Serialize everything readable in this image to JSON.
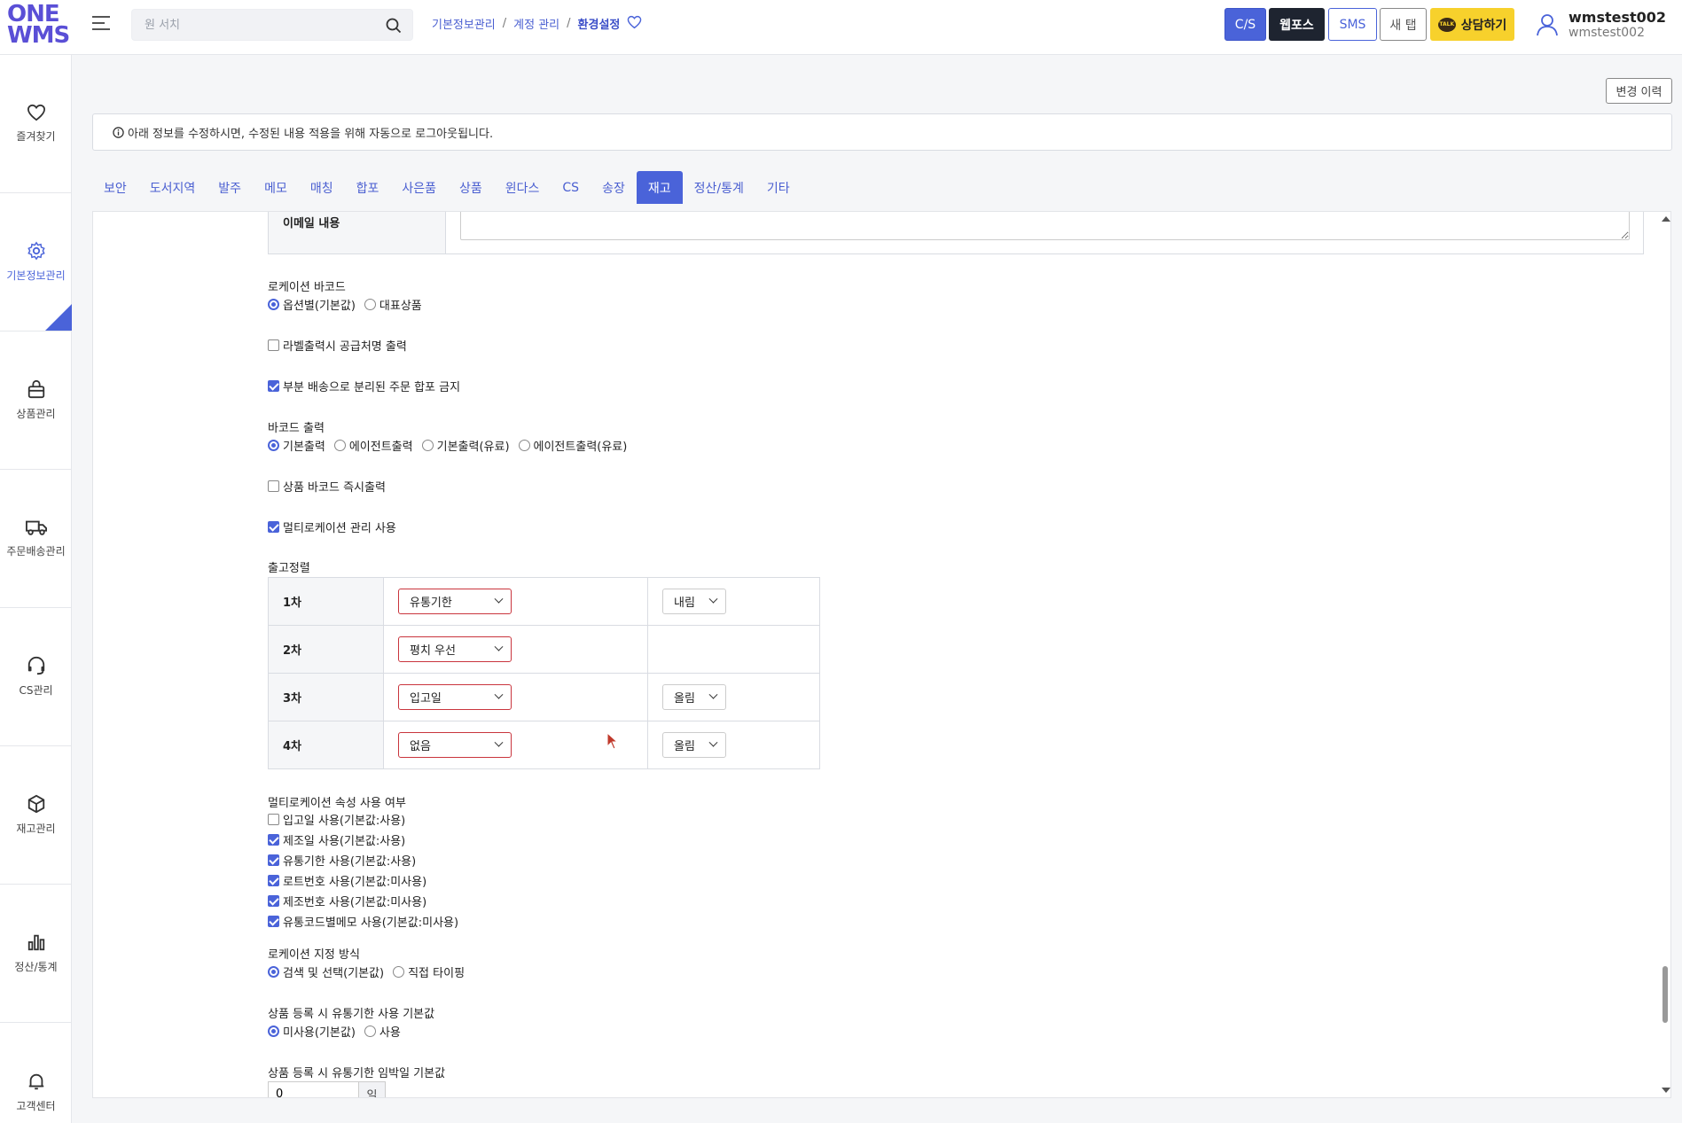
{
  "header": {
    "logo_line1": "ONE",
    "logo_line2": "WMS",
    "search_placeholder": "원 서치",
    "breadcrumb": [
      "기본정보관리",
      "계정 관리",
      "환경설정"
    ],
    "buttons": {
      "cs": "C/S",
      "web": "웹포스",
      "sms": "SMS",
      "newtab": "새 탭",
      "talk": "상담하기",
      "talk_badge": "TALK"
    },
    "user": {
      "name": "wmstest002",
      "id": "wmstest002"
    }
  },
  "sidebar": [
    {
      "label": "즐겨찾기",
      "icon": "heart-icon"
    },
    {
      "label": "기본정보관리",
      "icon": "gear-icon",
      "active": true
    },
    {
      "label": "상품관리",
      "icon": "bag-icon"
    },
    {
      "label": "주문배송관리",
      "icon": "truck-icon"
    },
    {
      "label": "CS관리",
      "icon": "headset-icon"
    },
    {
      "label": "재고관리",
      "icon": "box-icon"
    },
    {
      "label": "정산/통계",
      "icon": "bar-chart-icon"
    },
    {
      "label": "고객센터",
      "icon": "bell-icon"
    }
  ],
  "main": {
    "history_button": "변경 이력",
    "notice": "아래 정보를 수정하시면, 수정된 내용 적용을 위해 자동으로 로그아웃됩니다.",
    "tabs": [
      "보안",
      "도서지역",
      "발주",
      "메모",
      "매칭",
      "합포",
      "사은품",
      "상품",
      "윈다스",
      "CS",
      "송장",
      "재고",
      "정산/통계",
      "기타"
    ],
    "active_tab": "재고",
    "email_label": "이메일 내용",
    "location_barcode": {
      "label": "로케이션 바코드",
      "options": [
        "옵션별(기본값)",
        "대표상품"
      ],
      "selected": "옵션별(기본값)"
    },
    "label_print_supplier": {
      "label": "라벨출력시 공급처명 출력",
      "checked": false
    },
    "partial_ship_block": {
      "label": "부분 배송으로 분리된 주문 합포 금지",
      "checked": true
    },
    "barcode_output": {
      "label": "바코드 출력",
      "options": [
        "기본출력",
        "에이전트출력",
        "기본출력(유료)",
        "에이전트출력(유료)"
      ],
      "selected": "기본출력"
    },
    "instant_barcode": {
      "label": "상품 바코드 즉시출력",
      "checked": false
    },
    "multi_location": {
      "label": "멀티로케이션 관리 사용",
      "checked": true
    },
    "outbound_sort": {
      "label": "출고정렬",
      "rows": [
        {
          "rank": "1차",
          "field": "유통기한",
          "order": "내림"
        },
        {
          "rank": "2차",
          "field": "평치 우선",
          "order": ""
        },
        {
          "rank": "3차",
          "field": "입고일",
          "order": "올림"
        },
        {
          "rank": "4차",
          "field": "없음",
          "order": "올림"
        }
      ]
    },
    "multi_location_attrs": {
      "label": "멀티로케이션 속성 사용 여부",
      "items": [
        {
          "label": "입고일 사용(기본값:사용)",
          "checked": false
        },
        {
          "label": "제조일 사용(기본값:사용)",
          "checked": true
        },
        {
          "label": "유통기한 사용(기본값:사용)",
          "checked": true
        },
        {
          "label": "로트번호 사용(기본값:미사용)",
          "checked": true
        },
        {
          "label": "제조번호 사용(기본값:미사용)",
          "checked": true
        },
        {
          "label": "유통코드별메모 사용(기본값:미사용)",
          "checked": true
        }
      ]
    },
    "location_assign": {
      "label": "로케이션 지정 방식",
      "options": [
        "검색 및 선택(기본값)",
        "직접 타이핑"
      ],
      "selected": "검색 및 선택(기본값)"
    },
    "expiry_default": {
      "label": "상품 등록 시 유통기한 사용 기본값",
      "options": [
        "미사용(기본값)",
        "사용"
      ],
      "selected": "미사용(기본값)"
    },
    "expiry_imminent": {
      "label": "상품 등록 시 유통기한 임박일 기본값",
      "value": "0",
      "unit": "일"
    }
  },
  "colors": {
    "accent": "#4a63d9",
    "talk": "#f7d12c",
    "select_border": "#c9353d"
  }
}
